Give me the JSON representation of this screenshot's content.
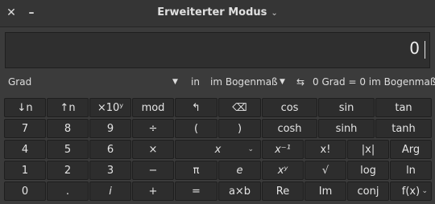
{
  "window": {
    "title": "Erweiterter Modus",
    "close_icon": "close-icon",
    "minimize_icon": "minimize-icon",
    "menu_icon": "chevron-down-icon"
  },
  "display": {
    "value": "0"
  },
  "unitbar": {
    "angle_unit": "Grad",
    "in_label": "in",
    "target_unit": "im Bogenmaß",
    "swap_icon": "swap-arrows-icon",
    "result": "0 Grad = 0 im Bogenmaß"
  },
  "buttons": {
    "r1": [
      "↓n",
      "↑n",
      "×10ʸ",
      "mod",
      "↰",
      "⌫",
      "cos",
      "sin",
      "tan"
    ],
    "r2": [
      "7",
      "8",
      "9",
      "÷",
      "(",
      ")",
      "cosh",
      "sinh",
      "tanh"
    ],
    "r3": [
      "4",
      "5",
      "6",
      "×",
      "x",
      "x⁻¹",
      "x!",
      "|x|",
      "Arg"
    ],
    "r4": [
      "1",
      "2",
      "3",
      "−",
      "π",
      "e",
      "xʸ",
      "√",
      "log",
      "ln"
    ],
    "r5": [
      "0",
      ".",
      "i",
      "+",
      "=",
      "a×b",
      "Re",
      "Im",
      "conj",
      "f(x)"
    ]
  }
}
